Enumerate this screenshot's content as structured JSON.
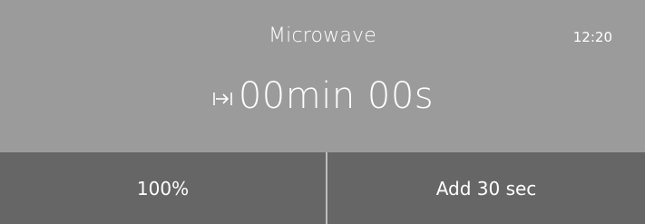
{
  "header": {
    "title": "Microwave",
    "clock": "12:20"
  },
  "timer": {
    "icon": "timer-arrow-to-bar-icon",
    "value": "00min 00s"
  },
  "controls": {
    "power_label": "100%",
    "add_time_label": "Add 30 sec"
  },
  "colors": {
    "top_background": "#9b9b9b",
    "button_background": "#666666",
    "divider": "#bdbdbd",
    "text": "#ffffff"
  }
}
